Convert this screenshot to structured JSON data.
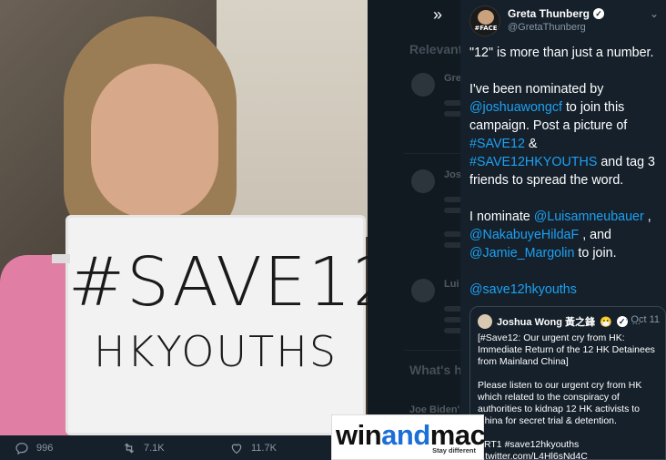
{
  "tweet": {
    "author_name": "Greta Thunberg",
    "author_handle": "@GretaThunberg",
    "avatar_label": "#FACE",
    "paragraphs": [
      "\"12\" is more than just a number.",
      "I've been nominated by",
      "to join this campaign. Post a picture of",
      "&",
      "and tag 3 friends to spread the word.",
      "I nominate",
      ",",
      ", and",
      "to join."
    ],
    "mentions": {
      "joshuawongcf": "@joshuawongcf",
      "save12": "#SAVE12",
      "save12hk": "#SAVE12HKYOUTHS",
      "luisa": "@Luisamneubauer",
      "hilda": "@NakabuyeHildaF",
      "jamie": "@Jamie_Margolin",
      "save12hkyouths": "@save12hkyouths"
    }
  },
  "quote": {
    "name": "Joshua Wong 黃之鋒",
    "emoji": "😷",
    "more": "...",
    "date": "· Oct 11",
    "line1": "[#Save12: Our urgent cry from HK: Immediate Return of the 12 HK Detainees from Mainland China]",
    "line2": "Please listen to our urgent cry from HK which related to the conspiracy of authorities to kidnap 12 HK activists to China for secret trial & detention.",
    "line3": "ART1 #save12hkyouths",
    "line4": "c.twitter.com/L4Hl6sNd4C"
  },
  "photo": {
    "sign_line1": "#SAVE12",
    "sign_line2": "HKYOUTHS"
  },
  "actions": {
    "replies": "996",
    "retweets": "7.1K",
    "likes": "11.7K"
  },
  "sidebar": {
    "relevant_heading": "Relevant",
    "whats_heading": "What's h",
    "item1_name": "Gre",
    "item2_name": "Jos",
    "item3_name": "Lui",
    "footer_text": "Joe Biden's"
  },
  "watermark": {
    "part1": "win",
    "part2": "and",
    "part3": "mac",
    "tagline": "Stay different"
  }
}
